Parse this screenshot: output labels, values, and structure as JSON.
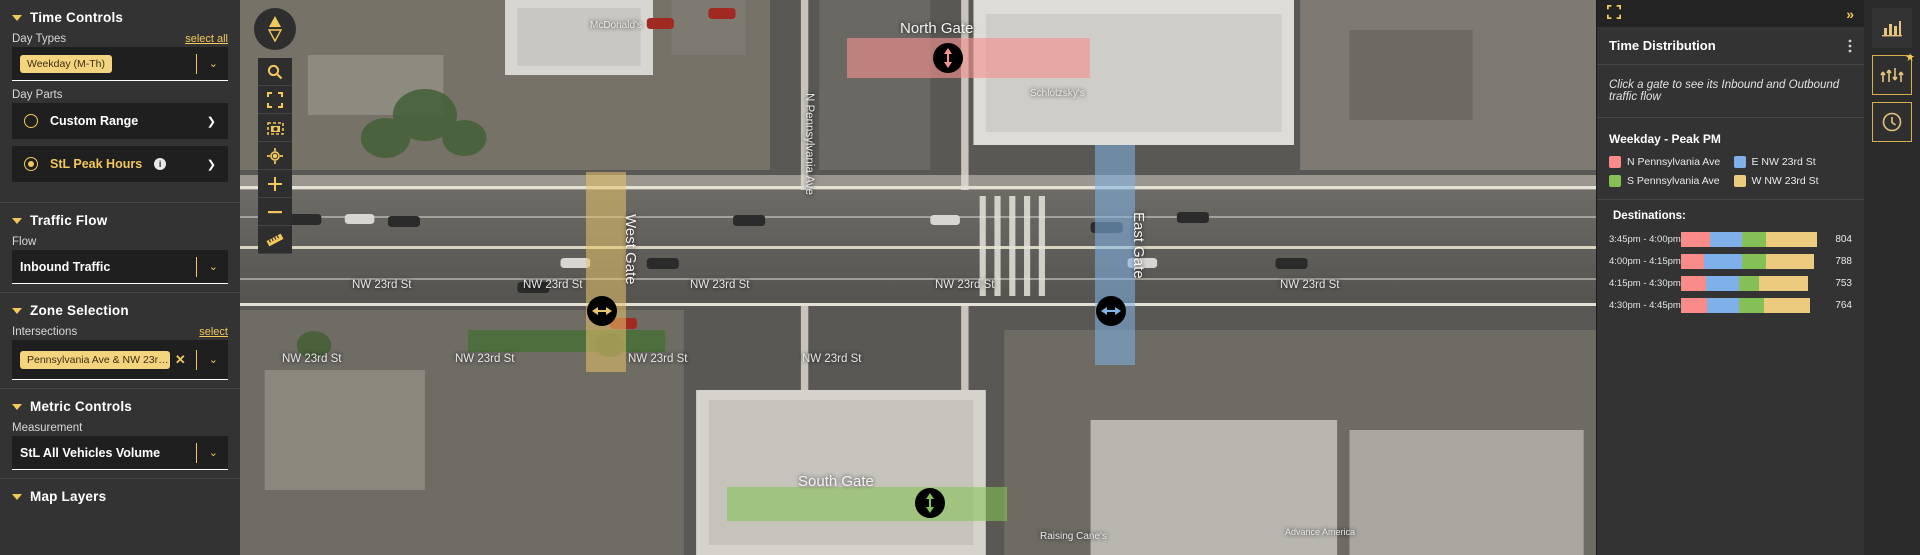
{
  "sidebar": {
    "sections": [
      {
        "id": "time-controls",
        "title": "Time Controls"
      },
      {
        "id": "traffic-flow",
        "title": "Traffic Flow"
      },
      {
        "id": "zone-selection",
        "title": "Zone Selection"
      },
      {
        "id": "metric-controls",
        "title": "Metric Controls"
      },
      {
        "id": "map-layers",
        "title": "Map Layers"
      }
    ],
    "day_types": {
      "label": "Day Types",
      "select_all": "select all",
      "chip": "Weekday (M-Th)",
      "chevron": "⌄"
    },
    "day_parts": {
      "label": "Day Parts",
      "options": [
        {
          "label": "Custom Range",
          "selected": false,
          "info": false
        },
        {
          "label": "StL Peak Hours",
          "selected": true,
          "info": true
        }
      ],
      "info_glyph": "i",
      "chevron_right": "❯"
    },
    "flow": {
      "label": "Flow",
      "value": "Inbound Traffic",
      "chevron": "⌄"
    },
    "zone": {
      "label": "Intersections",
      "select_link": "select",
      "chip": "Pennsylvania Ave & NW 23r…",
      "chip_remove": "✕",
      "clear_all": "✕",
      "chevron": "⌄"
    },
    "metric": {
      "label": "Measurement",
      "value": "StL All Vehicles Volume",
      "chevron": "⌄"
    }
  },
  "map": {
    "controls": [
      {
        "name": "compass-control",
        "title": "Compass"
      },
      {
        "name": "search-icon",
        "title": "Search"
      },
      {
        "name": "fullscreen-icon",
        "title": "Fullscreen"
      },
      {
        "name": "capture-icon",
        "title": "Capture area"
      },
      {
        "name": "locate-icon",
        "title": "Locate me"
      },
      {
        "name": "zoom-in-icon",
        "title": "Zoom in"
      },
      {
        "name": "zoom-out-icon",
        "title": "Zoom out"
      },
      {
        "name": "measure-icon",
        "title": "Measure"
      }
    ],
    "gates": [
      {
        "id": "north-gate",
        "label": "North Gate",
        "color": "#f4928e",
        "orientation": "vertical"
      },
      {
        "id": "south-gate",
        "label": "South Gate",
        "color": "#86c255",
        "orientation": "vertical"
      },
      {
        "id": "west-gate",
        "label": "West Gate",
        "color": "#e8c56a",
        "orientation": "horizontal"
      },
      {
        "id": "east-gate",
        "label": "East Gate",
        "color": "#7fb4e8",
        "orientation": "horizontal"
      }
    ],
    "street_labels": [
      "NW 23rd St",
      "NW 23rd St",
      "NW 23rd St",
      "NW 23rd St",
      "NW 23rd St",
      "NW 23rd St",
      "NW 23rd St",
      "NW 23rd St",
      "NW 23rd St"
    ],
    "avenue_label": "N Pennsylvania Ave",
    "poi_labels": [
      "McDonald's",
      "Schlotzsky's",
      "Raising Cane's",
      "Advance America"
    ]
  },
  "right_panel": {
    "expand_icon": "⛶",
    "collapse_icon": "»",
    "title": "Time Distribution",
    "menu_icon": "⋮",
    "hint": "Click a gate to see its Inbound and Outbound traffic flow",
    "subtitle": "Weekday - Peak PM",
    "destinations_label": "Destinations:"
  },
  "rail": {
    "buttons": [
      {
        "name": "bar-chart-icon",
        "selected": false,
        "starred": false
      },
      {
        "name": "traffic-flow-icon",
        "selected": true,
        "starred": true
      },
      {
        "name": "clock-icon",
        "selected": false,
        "starred": false
      }
    ],
    "star_glyph": "★"
  },
  "chart_data": {
    "type": "bar",
    "orientation": "horizontal",
    "stacked": true,
    "title": "Time Distribution",
    "subtitle": "Weekday - Peak PM",
    "group_label": "Destinations:",
    "xlabel": "",
    "ylabel": "",
    "legend_position": "top",
    "grid": false,
    "categories": [
      "3:45pm - 4:00pm",
      "4:00pm - 4:15pm",
      "4:15pm - 4:30pm",
      "4:30pm - 4:45pm"
    ],
    "series": [
      {
        "name": "N Pennsylvania Ave",
        "color": "#f98b88",
        "values": [
          170,
          135,
          145,
          155
        ]
      },
      {
        "name": "E NW 23rd St",
        "color": "#7fb0ea",
        "values": [
          190,
          228,
          198,
          190
        ]
      },
      {
        "name": "S Pennsylvania Ave",
        "color": "#84c055",
        "values": [
          145,
          138,
          120,
          145
        ]
      },
      {
        "name": "W NW 23rd St",
        "color": "#ecca7e",
        "values": [
          299,
          287,
          290,
          274
        ]
      }
    ],
    "totals": [
      804,
      788,
      753,
      764
    ],
    "total_labels": [
      "804",
      "788",
      "753",
      "764"
    ],
    "xlim": [
      0,
      804
    ]
  }
}
